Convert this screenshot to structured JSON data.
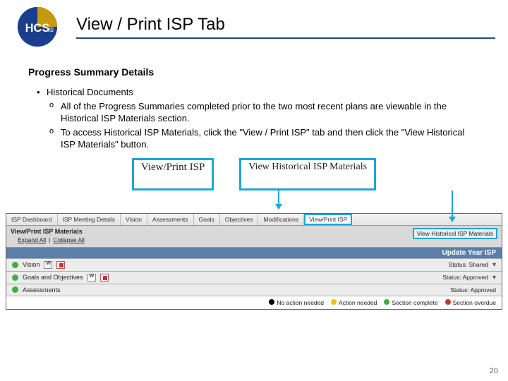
{
  "logo_text": "HCSis",
  "title": "View / Print ISP Tab",
  "subhead": "Progress Summary Details",
  "bullet": "Historical Documents",
  "sub_bullets": [
    "All of the Progress Summaries completed prior to the two most recent plans are viewable in the Historical ISP Materials section.",
    "To access Historical ISP Materials, click the \"View / Print ISP\" tab and then click the \"View Historical ISP Materials\" button."
  ],
  "callouts": {
    "view_print": "View/Print ISP",
    "view_hist": "View Historical ISP Materials"
  },
  "screenshot": {
    "tabs": [
      "ISP Dashboard",
      "ISP Meeting Details",
      "Vision",
      "Assessments",
      "Goals",
      "Objectives",
      "Modifications",
      "View/Print ISP"
    ],
    "active_tab_index": 7,
    "panel_title": "View/Print ISP Materials",
    "links": [
      "Expand All",
      "Collapse All"
    ],
    "hist_button": "View Historical ISP Materials",
    "year_bar": "Update Year ISP",
    "sections": [
      {
        "name": "Vision",
        "status": "Status: Shared",
        "icons": true
      },
      {
        "name": "Goals and Objectives",
        "status": "Status: Approved",
        "icons": true
      },
      {
        "name": "Assessments",
        "status": "Status: Approved",
        "icons": false
      }
    ],
    "legend": [
      {
        "color": "black",
        "label": "No action needed"
      },
      {
        "color": "yellow",
        "label": "Action needed"
      },
      {
        "color": "green",
        "label": "Section complete"
      },
      {
        "color": "red",
        "label": "Section overdue"
      }
    ]
  },
  "page_number": "20"
}
